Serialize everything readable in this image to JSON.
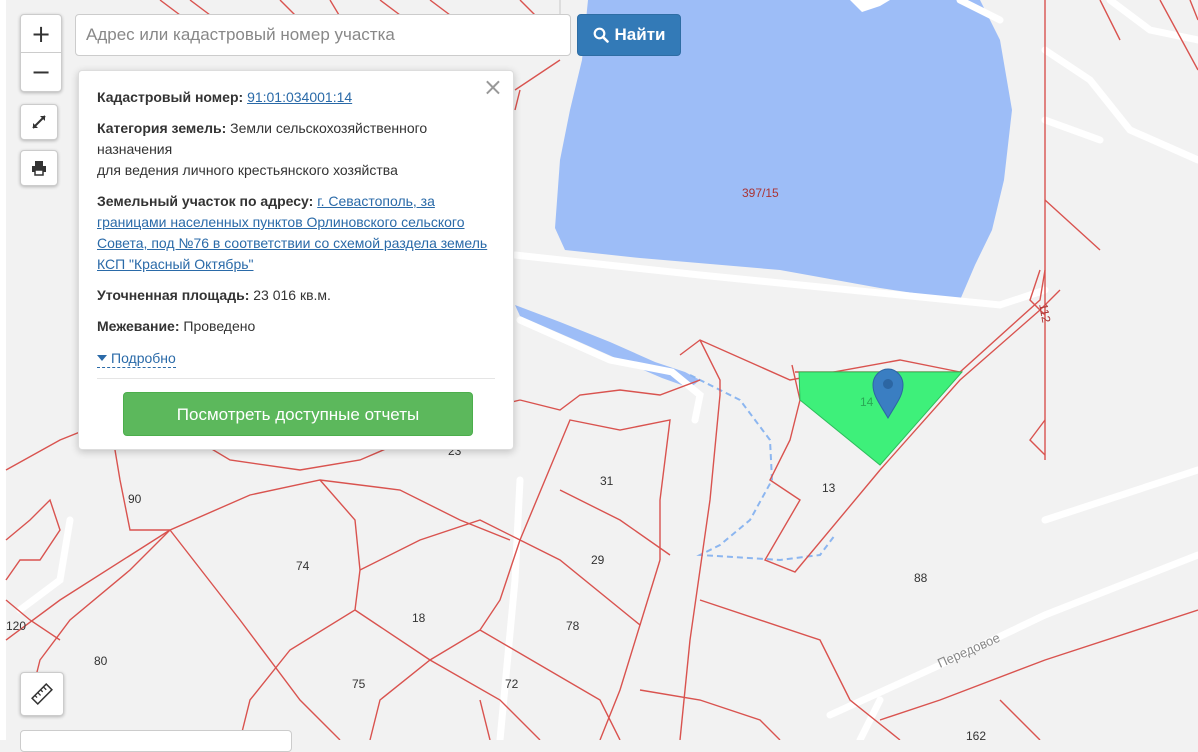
{
  "search": {
    "placeholder": "Адрес или кадастровый номер участка",
    "button_label": "Найти"
  },
  "zoom": {
    "plus": "+",
    "minus": "−"
  },
  "tools": {
    "fullscreen_icon": "fullscreen-icon",
    "print_icon": "print-icon",
    "ruler_icon": "ruler-icon"
  },
  "popup": {
    "cadastral_label": "Кадастровый номер:",
    "cadastral_value": "91:01:034001:14",
    "category_label": "Категория земель:",
    "category_value_line1": "Земли сельскохозяйственного",
    "category_value_line2": "назначения",
    "category_value_line3": "для ведения личного крестьянского хозяйства",
    "address_label": "Земельный участок по адресу:",
    "address_value": "г. Севастополь, за границами населенных пунктов Орлиновского сельского Совета, под №76 в соответствии со схемой раздела земель КСП \"Красный Октябрь\"",
    "area_label": "Уточненная площадь:",
    "area_value": "23 016 кв.м.",
    "survey_label": "Межевание:",
    "survey_value": "Проведено",
    "more_link": "Подробно",
    "reports_button": "Посмотреть доступные отчеты",
    "close": "×"
  },
  "map": {
    "water_color": "#9dbdf7",
    "selected_parcel_color": "#3ef07a",
    "parcel_line_color": "#d9534f",
    "marker_color": "#3a7ec2",
    "parcel_labels": {
      "p397": "397/15",
      "p14": "14",
      "p13": "13",
      "p31": "31",
      "p29": "29",
      "p78": "78",
      "p88": "88",
      "p90": "90",
      "p74": "74",
      "p18": "18",
      "p75": "75",
      "p72": "72",
      "p80": "80",
      "p120": "120",
      "p23": "23",
      "p162": "162",
      "p112": "112"
    },
    "street_name": "Передовое"
  }
}
